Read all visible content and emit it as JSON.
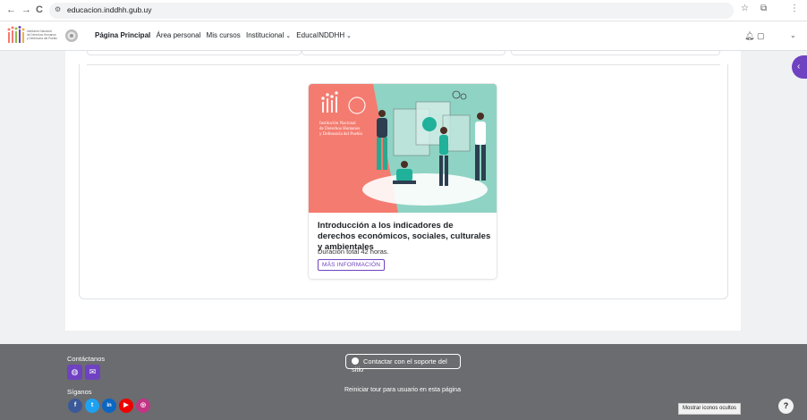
{
  "browser": {
    "url": "educacion.inddhh.gub.uy",
    "back": "←",
    "forward": "→",
    "reload": "C"
  },
  "logo": {
    "line1": "Institución Nacional",
    "line2": "de Derechos Humanos",
    "line3": "y Defensoría del Pueblo"
  },
  "menu": {
    "items": [
      {
        "label": "Página Principal",
        "active": true
      },
      {
        "label": "Área personal"
      },
      {
        "label": "Mis cursos"
      },
      {
        "label": "Institucional"
      },
      {
        "label": "EducaINDDHH"
      }
    ]
  },
  "course": {
    "title": "Introducción a los indicadores de derechos económicos, sociales, culturales y ambientales",
    "duration": "Duración total 42 horas.",
    "more_label": "MÁS INFORMACIÓN",
    "image_text": "Institución Nacional de Derechos Humanos y Defensoría del Pueblo"
  },
  "footer": {
    "contact_label": "Contáctanos",
    "follow_label": "Síganos",
    "support_label": "Contactar con el soporte del sitio",
    "tour_label": "Reiniciar tour para usuario en esta página",
    "hidden_icons_label": "Mostrar iconos ocultos",
    "help_label": "?"
  },
  "colors": {
    "accent": "#6f42c1",
    "footer_bg": "#6a6c6f",
    "hero_left": "#f47b6f",
    "hero_right": "#8fd3c4"
  }
}
